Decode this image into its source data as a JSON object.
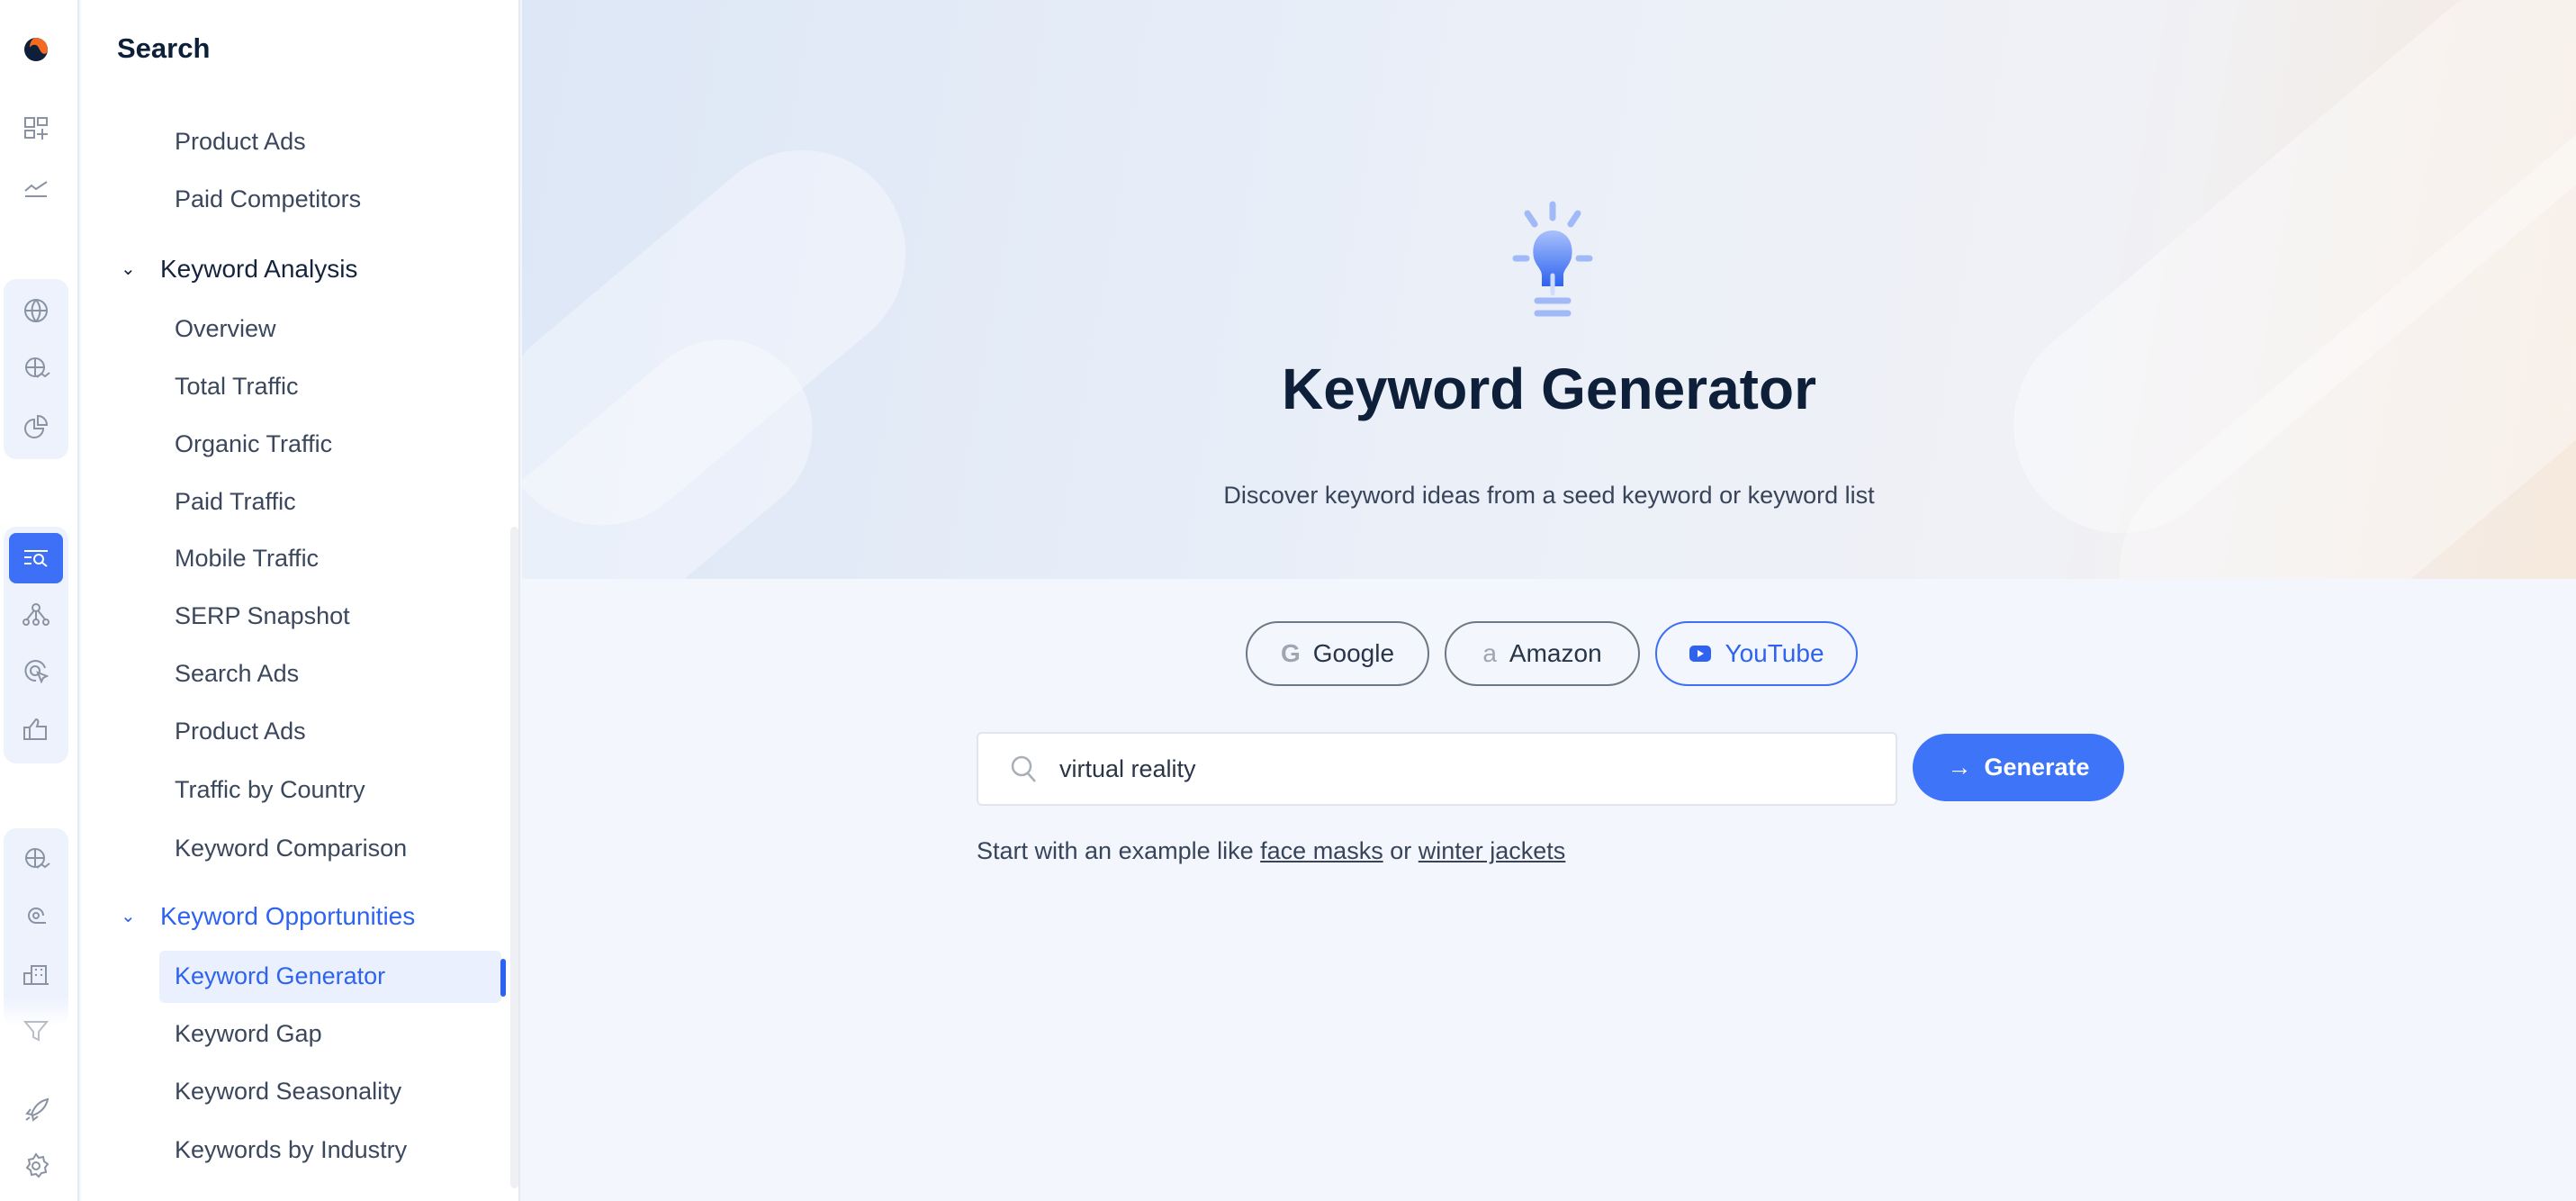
{
  "sidebar": {
    "title": "Search",
    "items": [
      {
        "label": "Product Ads",
        "type": "item"
      },
      {
        "label": "Paid Competitors",
        "type": "item"
      },
      {
        "label": "Keyword Analysis",
        "type": "section"
      },
      {
        "label": "Overview",
        "type": "item"
      },
      {
        "label": "Total Traffic",
        "type": "item"
      },
      {
        "label": "Organic Traffic",
        "type": "item"
      },
      {
        "label": "Paid Traffic",
        "type": "item"
      },
      {
        "label": "Mobile Traffic",
        "type": "item"
      },
      {
        "label": "SERP Snapshot",
        "type": "item"
      },
      {
        "label": "Search Ads",
        "type": "item"
      },
      {
        "label": "Product Ads",
        "type": "item"
      },
      {
        "label": "Traffic by Country",
        "type": "item"
      },
      {
        "label": "Keyword Comparison",
        "type": "item"
      },
      {
        "label": "Keyword Opportunities",
        "type": "section",
        "active": true
      },
      {
        "label": "Keyword Generator",
        "type": "item",
        "active": true
      },
      {
        "label": "Keyword Gap",
        "type": "item"
      },
      {
        "label": "Keyword Seasonality",
        "type": "item"
      },
      {
        "label": "Keywords by Industry",
        "type": "item"
      }
    ]
  },
  "main": {
    "title": "Keyword Generator",
    "subtitle": "Discover keyword ideas from a seed keyword or keyword list",
    "sources": [
      {
        "label": "Google",
        "icon": "google-icon"
      },
      {
        "label": "Amazon",
        "icon": "amazon-icon"
      },
      {
        "label": "YouTube",
        "icon": "youtube-icon",
        "selected": true
      }
    ],
    "search_value": "virtual reality",
    "generate_label": "Generate",
    "example_prefix": "Start with an example like",
    "example_1": "face masks",
    "example_or": "or",
    "example_2": "winter jackets"
  },
  "colors": {
    "accent": "#3e74f7",
    "logo_orange": "#f26b21",
    "logo_navy": "#0e1f3a"
  }
}
